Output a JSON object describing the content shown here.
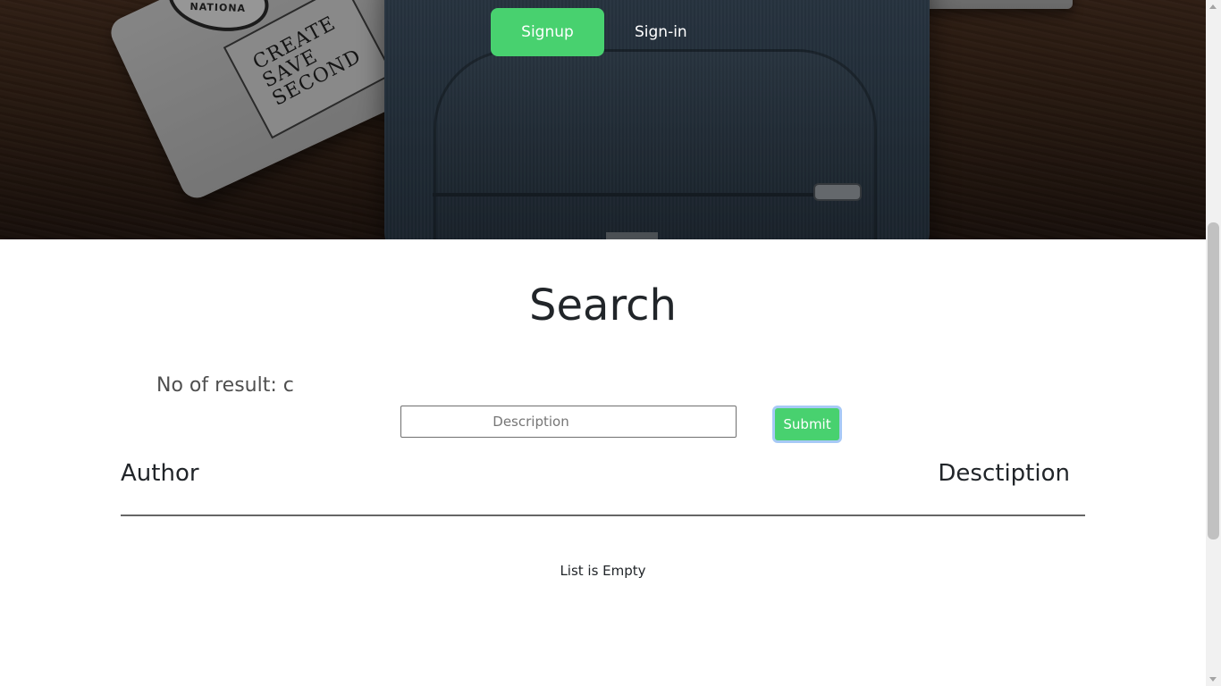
{
  "header": {
    "signup_label": "Signup",
    "signin_label": "Sign-in",
    "hero_sticker_left": "NATIONA",
    "hero_sticker_right": "CREATE SAVE SECOND"
  },
  "search": {
    "title": "Search",
    "results_count": "No of result: c",
    "input_placeholder": "Description",
    "input_value": "",
    "submit_label": "Submit"
  },
  "table": {
    "columns": [
      "Author",
      "Desctiption"
    ],
    "empty_message": "List is Empty"
  },
  "colors": {
    "accent": "#48D16F",
    "text": "#212529",
    "muted": "#4F4F4F"
  }
}
